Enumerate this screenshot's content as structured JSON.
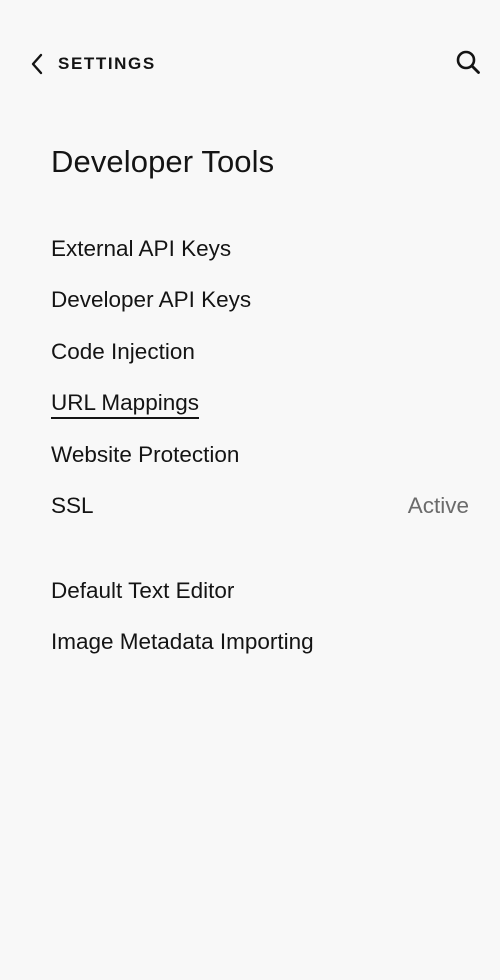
{
  "header": {
    "back_label": "SETTINGS",
    "back_icon": "chevron-left-icon",
    "search_icon": "search-icon"
  },
  "page": {
    "title": "Developer Tools"
  },
  "menu": {
    "items": [
      {
        "label": "External API Keys"
      },
      {
        "label": "Developer API Keys"
      },
      {
        "label": "Code Injection"
      },
      {
        "label": "URL Mappings",
        "selected": true
      },
      {
        "label": "Website Protection"
      },
      {
        "label": "SSL",
        "status": "Active"
      },
      {
        "label": "Default Text Editor"
      },
      {
        "label": "Image Metadata Importing"
      }
    ]
  },
  "colors": {
    "background": "#f8f8f8",
    "text": "#141414",
    "muted": "#6b6b6b"
  }
}
